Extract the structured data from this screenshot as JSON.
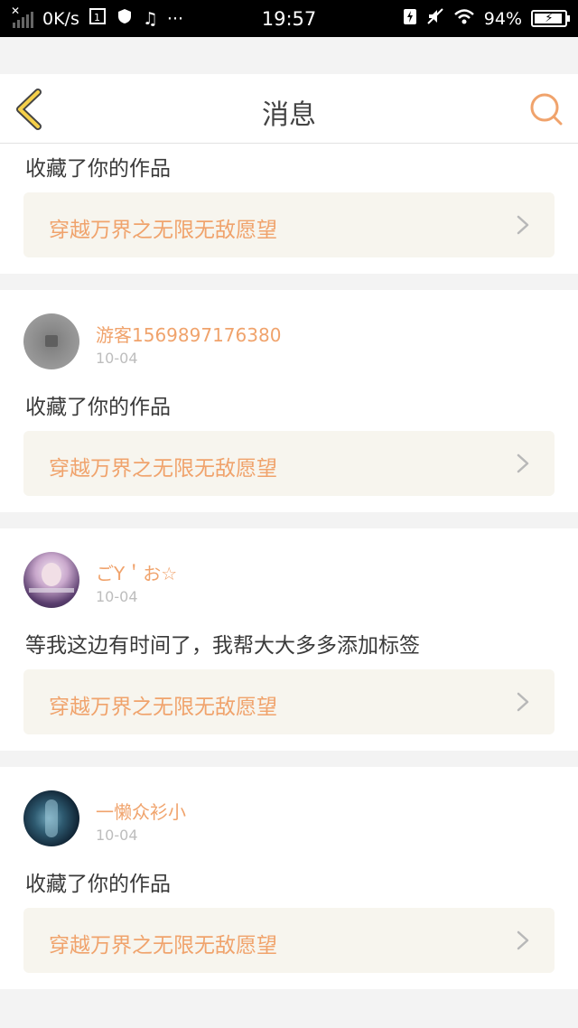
{
  "status_bar": {
    "net_speed": "0K/s",
    "time": "19:57",
    "battery": "94%",
    "icons": [
      "signal-icon",
      "sim-icon",
      "shield-icon",
      "music-icon",
      "more-icon",
      "charging-icon",
      "mute-icon",
      "wifi-icon",
      "battery-icon"
    ]
  },
  "header": {
    "title": "消息",
    "back_icon": "chevron-left-icon",
    "search_icon": "search-icon",
    "accent": "#f0a36c"
  },
  "messages": [
    {
      "action": "收藏了你的作品",
      "work_title": "穿越万界之无限无敌愿望"
    },
    {
      "username": "游客1569897176380",
      "date": "10-04",
      "action": "收藏了你的作品",
      "work_title": "穿越万界之无限无敌愿望"
    },
    {
      "username": "ごY＇お☆",
      "date": "10-04",
      "action": "等我这边有时间了，我帮大大多多添加标签",
      "work_title": "穿越万界之无限无敌愿望"
    },
    {
      "username": "一懒众衫小",
      "date": "10-04",
      "action": "收藏了你的作品",
      "work_title": "穿越万界之无限无敌愿望"
    }
  ]
}
